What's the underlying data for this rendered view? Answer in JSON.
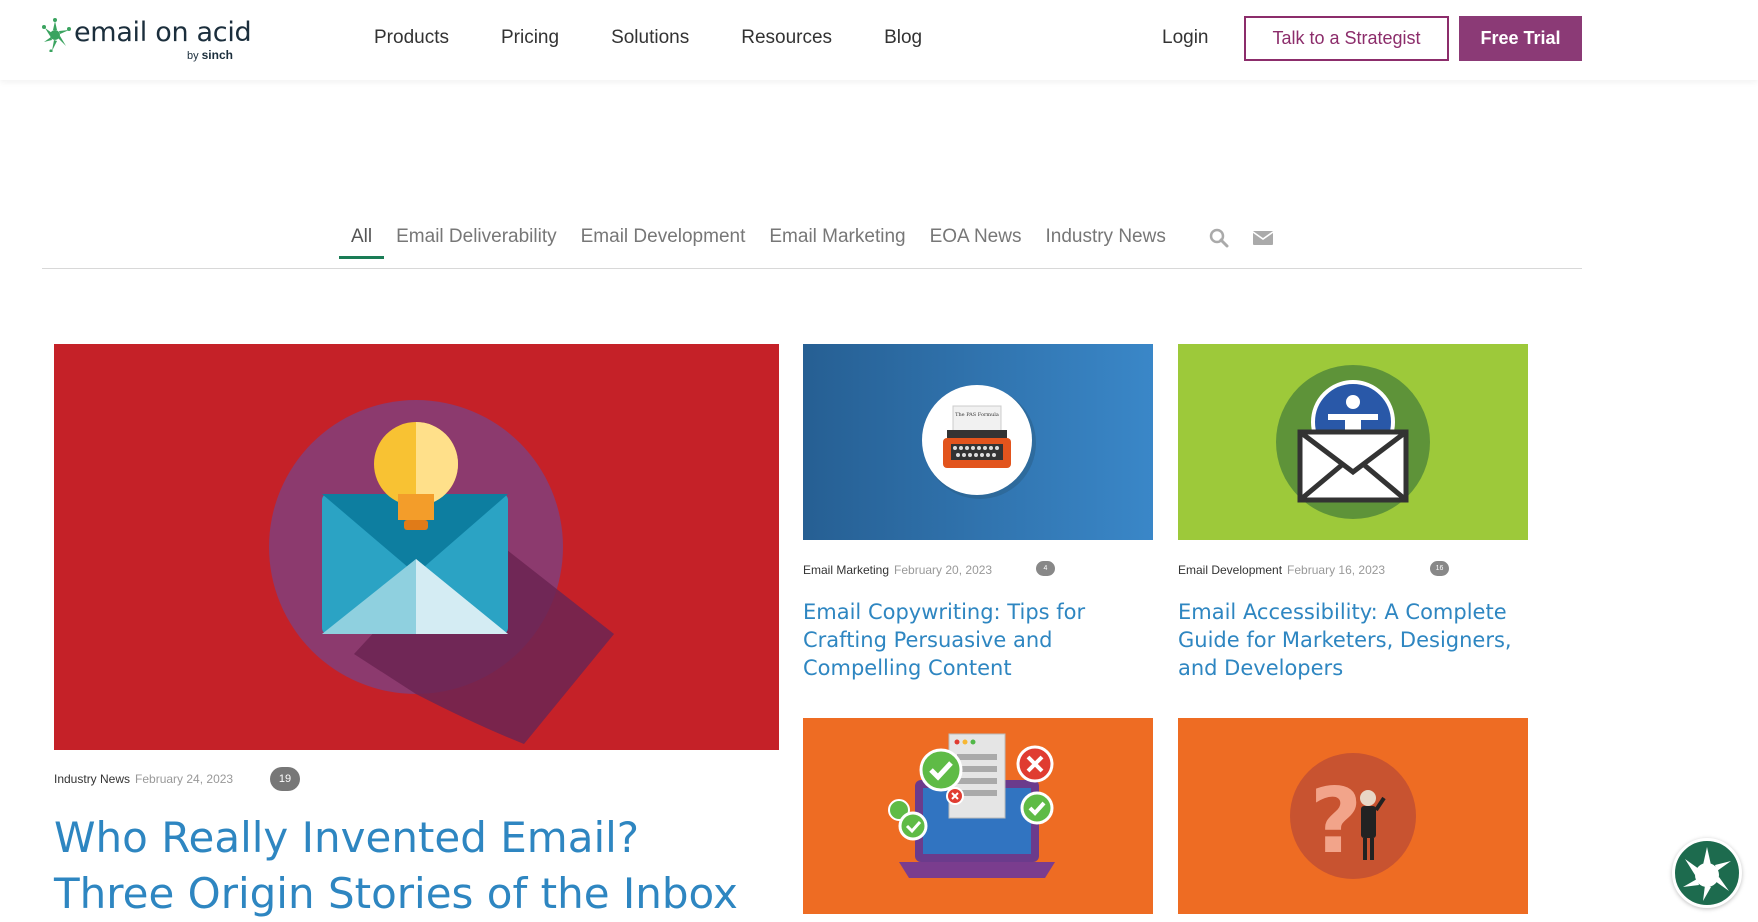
{
  "brand": {
    "name": "email on acid",
    "sub_by": "by",
    "sub_name": "sinch",
    "accent": "#8b3a76",
    "link": "#2e86c1",
    "green": "#1a7c56"
  },
  "nav": {
    "items": [
      "Products",
      "Pricing",
      "Solutions",
      "Resources",
      "Blog"
    ],
    "login": "Login",
    "strategist_button": "Talk to a Strategist",
    "trial_button": "Free Trial"
  },
  "filters": {
    "tabs": [
      "All",
      "Email Deliverability",
      "Email Development",
      "Email Marketing",
      "EOA News",
      "Industry News"
    ],
    "active": "All"
  },
  "posts": {
    "featured": {
      "category": "Industry News",
      "date": "February 24, 2023",
      "comments": "19",
      "title": "Who Really Invented Email? Three Origin Stories of the Inbox",
      "image_icon": "lightbulb-envelope-icon"
    },
    "card1": {
      "category": "Email Marketing",
      "date": "February 20, 2023",
      "comments": "4",
      "title": "Email Copywriting: Tips for Crafting Persuasive and Compelling Content",
      "image_icon": "typewriter-icon",
      "image_text": "The PAS Formula"
    },
    "card2": {
      "category": "Email Development",
      "date": "February 16, 2023",
      "comments": "16",
      "title": "Email Accessibility: A Complete Guide for Marketers, Designers, and Developers",
      "image_icon": "accessibility-envelope-icon"
    },
    "card3": {
      "image_icon": "laptop-checklist-icon"
    },
    "card4": {
      "image_icon": "question-mark-person-icon"
    }
  }
}
